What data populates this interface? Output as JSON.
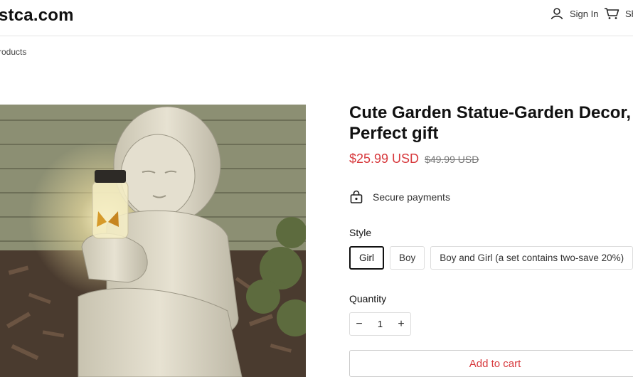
{
  "header": {
    "logo": "stca.com",
    "sign_in": "Sign In",
    "cart": "Sh"
  },
  "breadcrumb": "roducts",
  "product": {
    "title_line1": "Cute Garden Statue-Garden Decor,",
    "title_line2": "Perfect gift",
    "price": "$25.99 USD",
    "compare_price": "$49.99 USD",
    "secure_payments": "Secure payments",
    "style_label": "Style",
    "style_options": [
      "Girl",
      "Boy",
      "Boy and Girl (a set contains two-save 20%)"
    ],
    "selected_style": "Girl",
    "quantity_label": "Quantity",
    "quantity": "1",
    "add_to_cart": "Add to cart"
  },
  "colors": {
    "sale": "#d7383c",
    "text": "#111111",
    "border": "#dddddd"
  }
}
